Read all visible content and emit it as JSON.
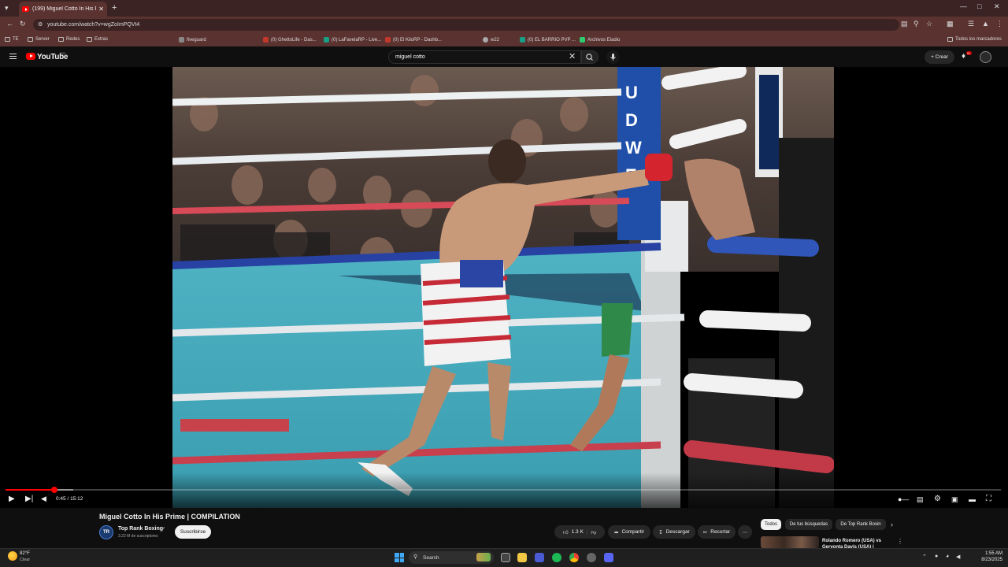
{
  "browser": {
    "tab_title": "(199) Miguel Cotto In His Prime",
    "url": "youtube.com/watch?v=wgZoImPQVt4",
    "bookmarks": [
      "TE",
      "Server",
      "Redes",
      "Extras",
      "fiveguard",
      "(0) GhettoLife - Das...",
      "(0) LaFavelaRP - Live...",
      "(0) El KiloRP - Dashb...",
      "w22",
      "(0) EL BARRIO PVP ...",
      "Archivos Eladio"
    ],
    "all_bookmarks": "Todos los marcadores"
  },
  "youtube": {
    "wordmark": "YouTube",
    "country": "DO",
    "search_value": "miguel cotto",
    "create_label": "Crear",
    "notif_count": "9+"
  },
  "player": {
    "current_time": "0:45 / 15:12",
    "played_fraction": 0.049,
    "buffered_fraction": 0.068
  },
  "video": {
    "title": "Miguel Cotto In His Prime | COMPILATION",
    "channel_initials": "TR",
    "channel_name": "Top Rank Boxing",
    "subscribers": "3.22 M de suscriptores",
    "subscribe_label": "Suscribirse",
    "like_count": "1.3 K",
    "share_label": "Compartir",
    "download_label": "Descargar",
    "clip_label": "Recortar"
  },
  "chips": [
    "Todos",
    "De tus búsquedas",
    "De Top Rank Boxin"
  ],
  "recommendation": {
    "title": "Rolando Romero (USA) vs Gervonta Davis (USA) |"
  },
  "taskbar": {
    "temp": "82°F",
    "condition": "Clear",
    "search_label": "Search",
    "time": "1:55 AM",
    "date": "8/23/2025"
  },
  "colors": {
    "accent": "#ff0000",
    "chrome_bg": "#5a3230",
    "page_bg": "#0f0f0f"
  }
}
